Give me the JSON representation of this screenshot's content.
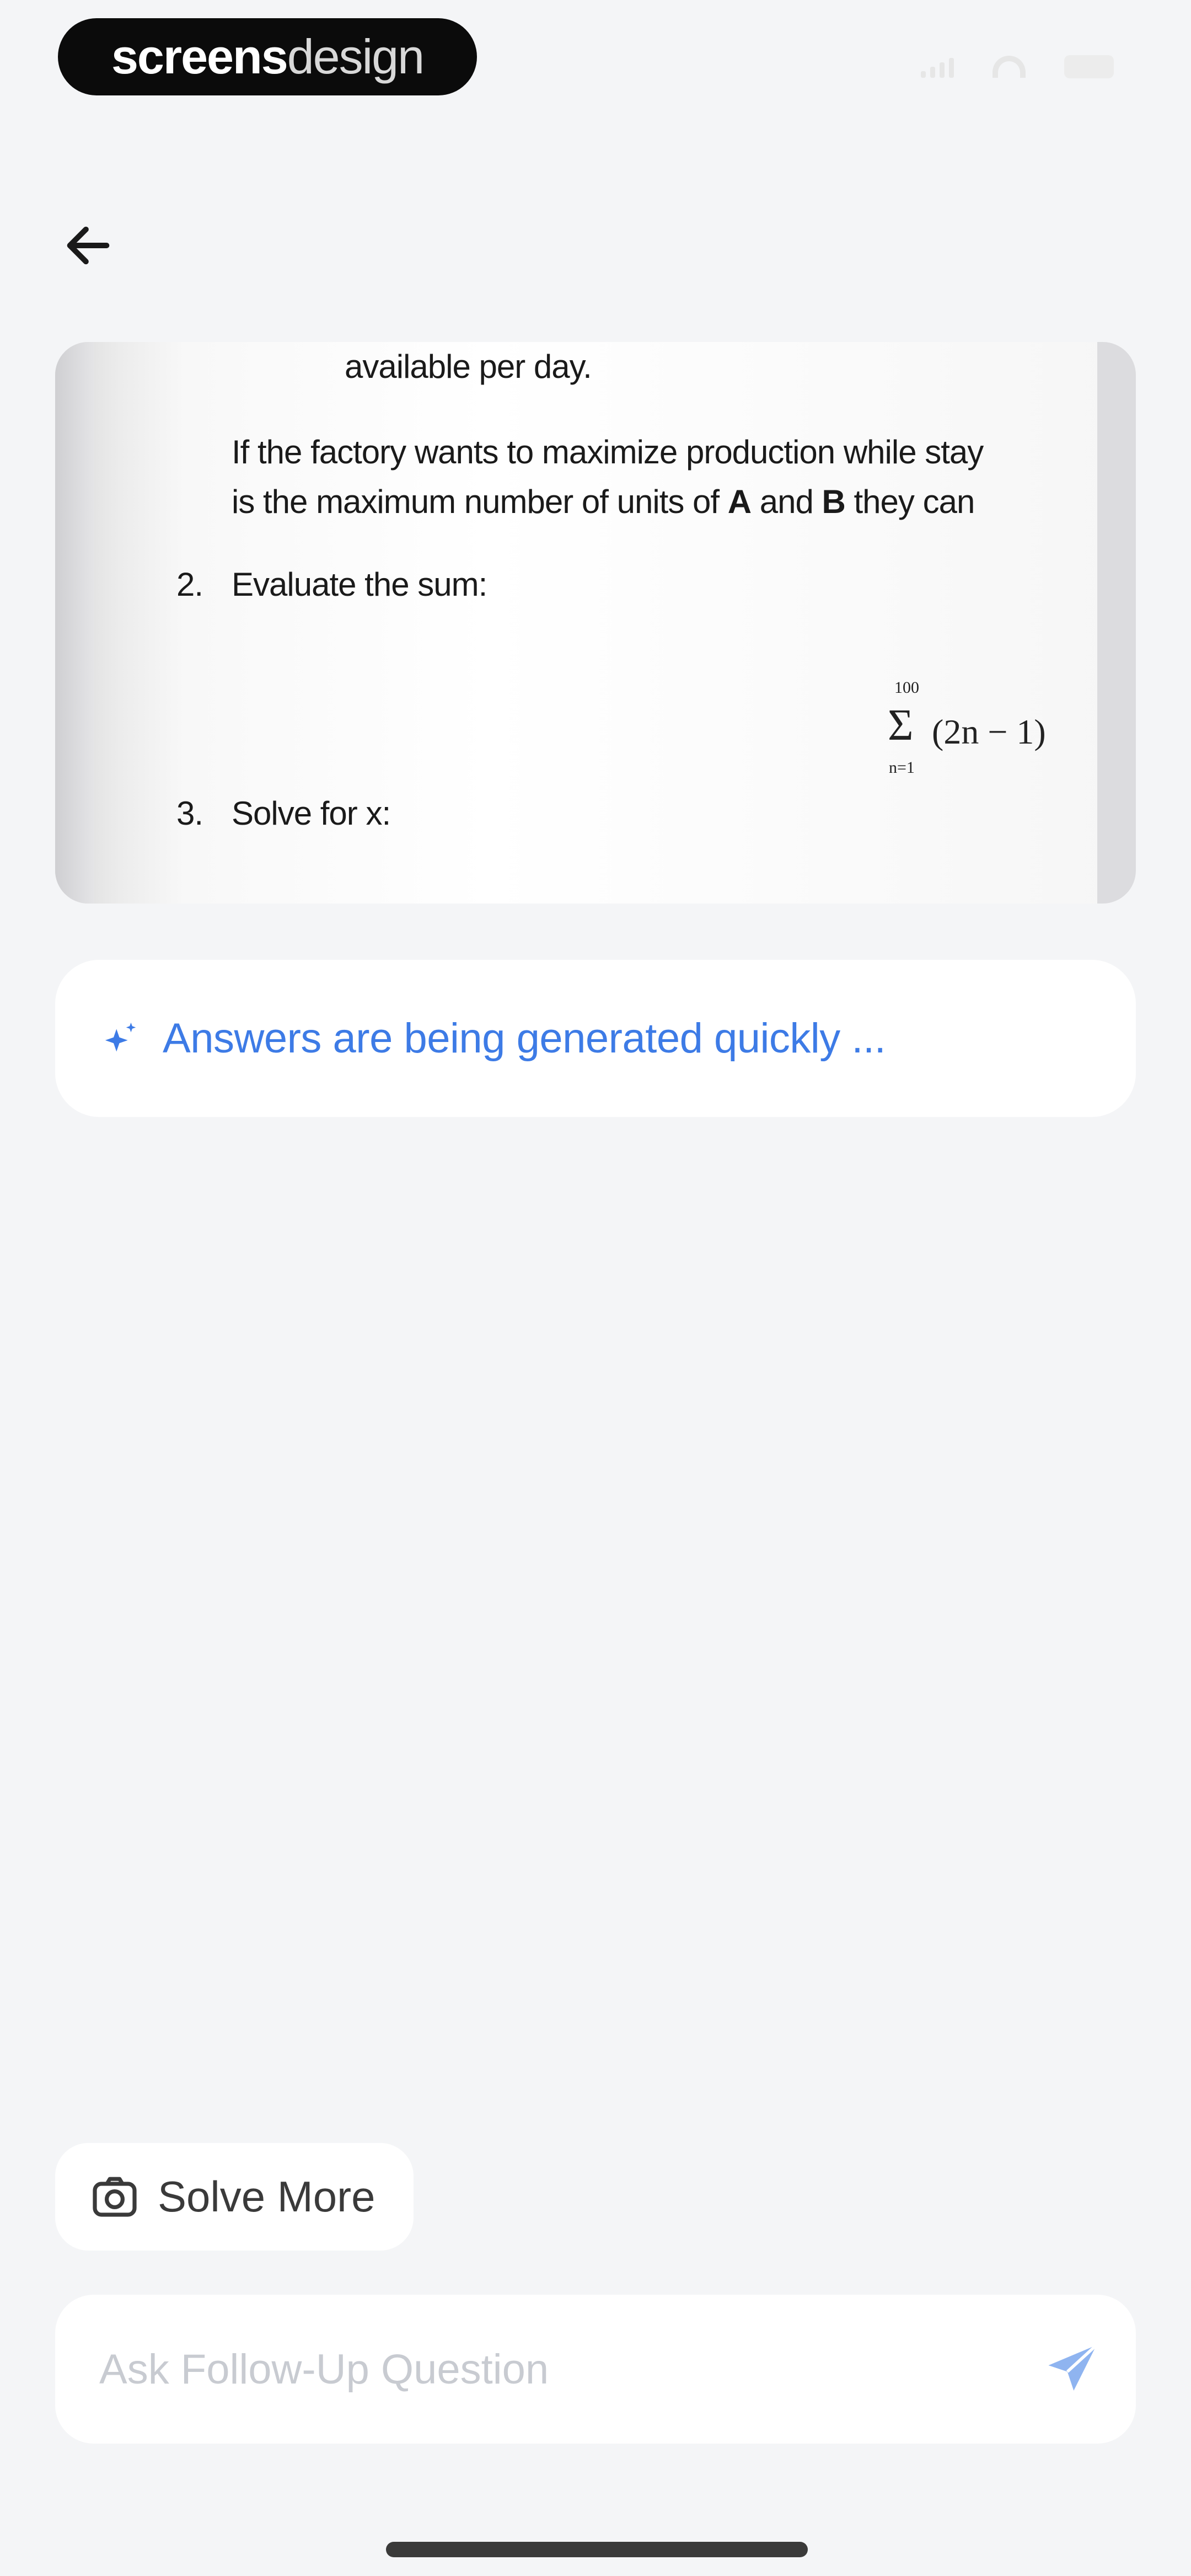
{
  "status_bar": {
    "badge_part1": "screens",
    "badge_part2": "design",
    "icons": [
      "signal-icon",
      "wifi-icon",
      "battery-icon"
    ]
  },
  "nav": {
    "back_icon": "arrow-left-icon"
  },
  "scan": {
    "line1": "available per day.",
    "line2": "If the factory wants to maximize production while stay",
    "line3_pre": "is the maximum number of units of ",
    "line3_a": "A",
    "line3_mid": " and ",
    "line3_b": "B",
    "line3_post": " they can",
    "q2_num": "2.",
    "q2_text": "Evaluate the sum:",
    "formula_top": "100",
    "formula_sigma": "Σ",
    "formula_bottom": "n=1",
    "formula_expr": "(2n − 1)",
    "q3_num": "3.",
    "q3_text": "Solve for x:"
  },
  "status": {
    "icon": "sparkle-icon",
    "text": "Answers are being generated quickly ..."
  },
  "actions": {
    "solve_more_icon": "camera-icon",
    "solve_more_label": "Solve More"
  },
  "followup": {
    "placeholder": "Ask Follow-Up Question",
    "value": "",
    "send_icon": "send-icon"
  },
  "colors": {
    "accent": "#3d7be6",
    "send_icon": "#8fb4f0",
    "background": "#f4f5f7",
    "card": "#ffffff"
  }
}
